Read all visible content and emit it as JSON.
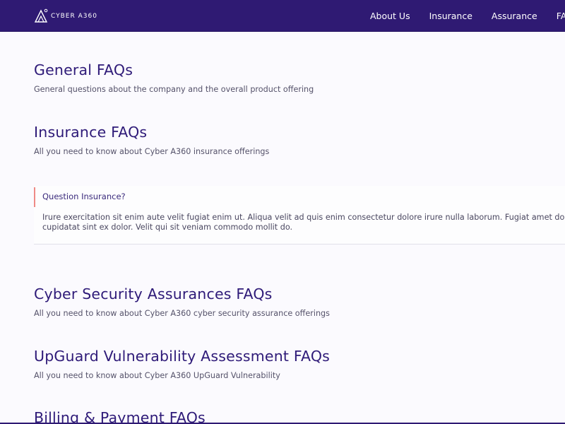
{
  "brand": {
    "logo_text": "CYBER A360"
  },
  "nav": {
    "items": [
      {
        "label": "About Us"
      },
      {
        "label": "Insurance"
      },
      {
        "label": "Assurance"
      },
      {
        "label": "FAQ"
      }
    ]
  },
  "sections": [
    {
      "title": "General FAQs",
      "subtitle": "General questions about the company and the overall product offering"
    },
    {
      "title": "Insurance FAQs",
      "subtitle": "All you need to know about Cyber A360 insurance offerings"
    },
    {
      "title": "Cyber Security Assurances FAQs",
      "subtitle": "All you need to know about Cyber A360 cyber security assurance offerings"
    },
    {
      "title": "UpGuard Vulnerability Assessment FAQs",
      "subtitle": "All you need to know about Cyber A360 UpGuard Vulnerability"
    },
    {
      "title": "Billing & Payment FAQs",
      "subtitle": ""
    }
  ],
  "faq_item": {
    "question": "Question Insurance?",
    "answer_line1": "Irure exercitation sit enim aute velit fugiat enim ut. Aliqua velit ad quis enim consectetur dolore irure nulla laborum. Fugiat amet do",
    "answer_line2": "cupidatat sint ex dolor. Velit qui sit veniam commodo mollit do."
  },
  "colors": {
    "navbar": "#2f1a73",
    "heading": "#2e1a78",
    "accent_bar": "#ef8a86",
    "background": "#fbfafe"
  }
}
